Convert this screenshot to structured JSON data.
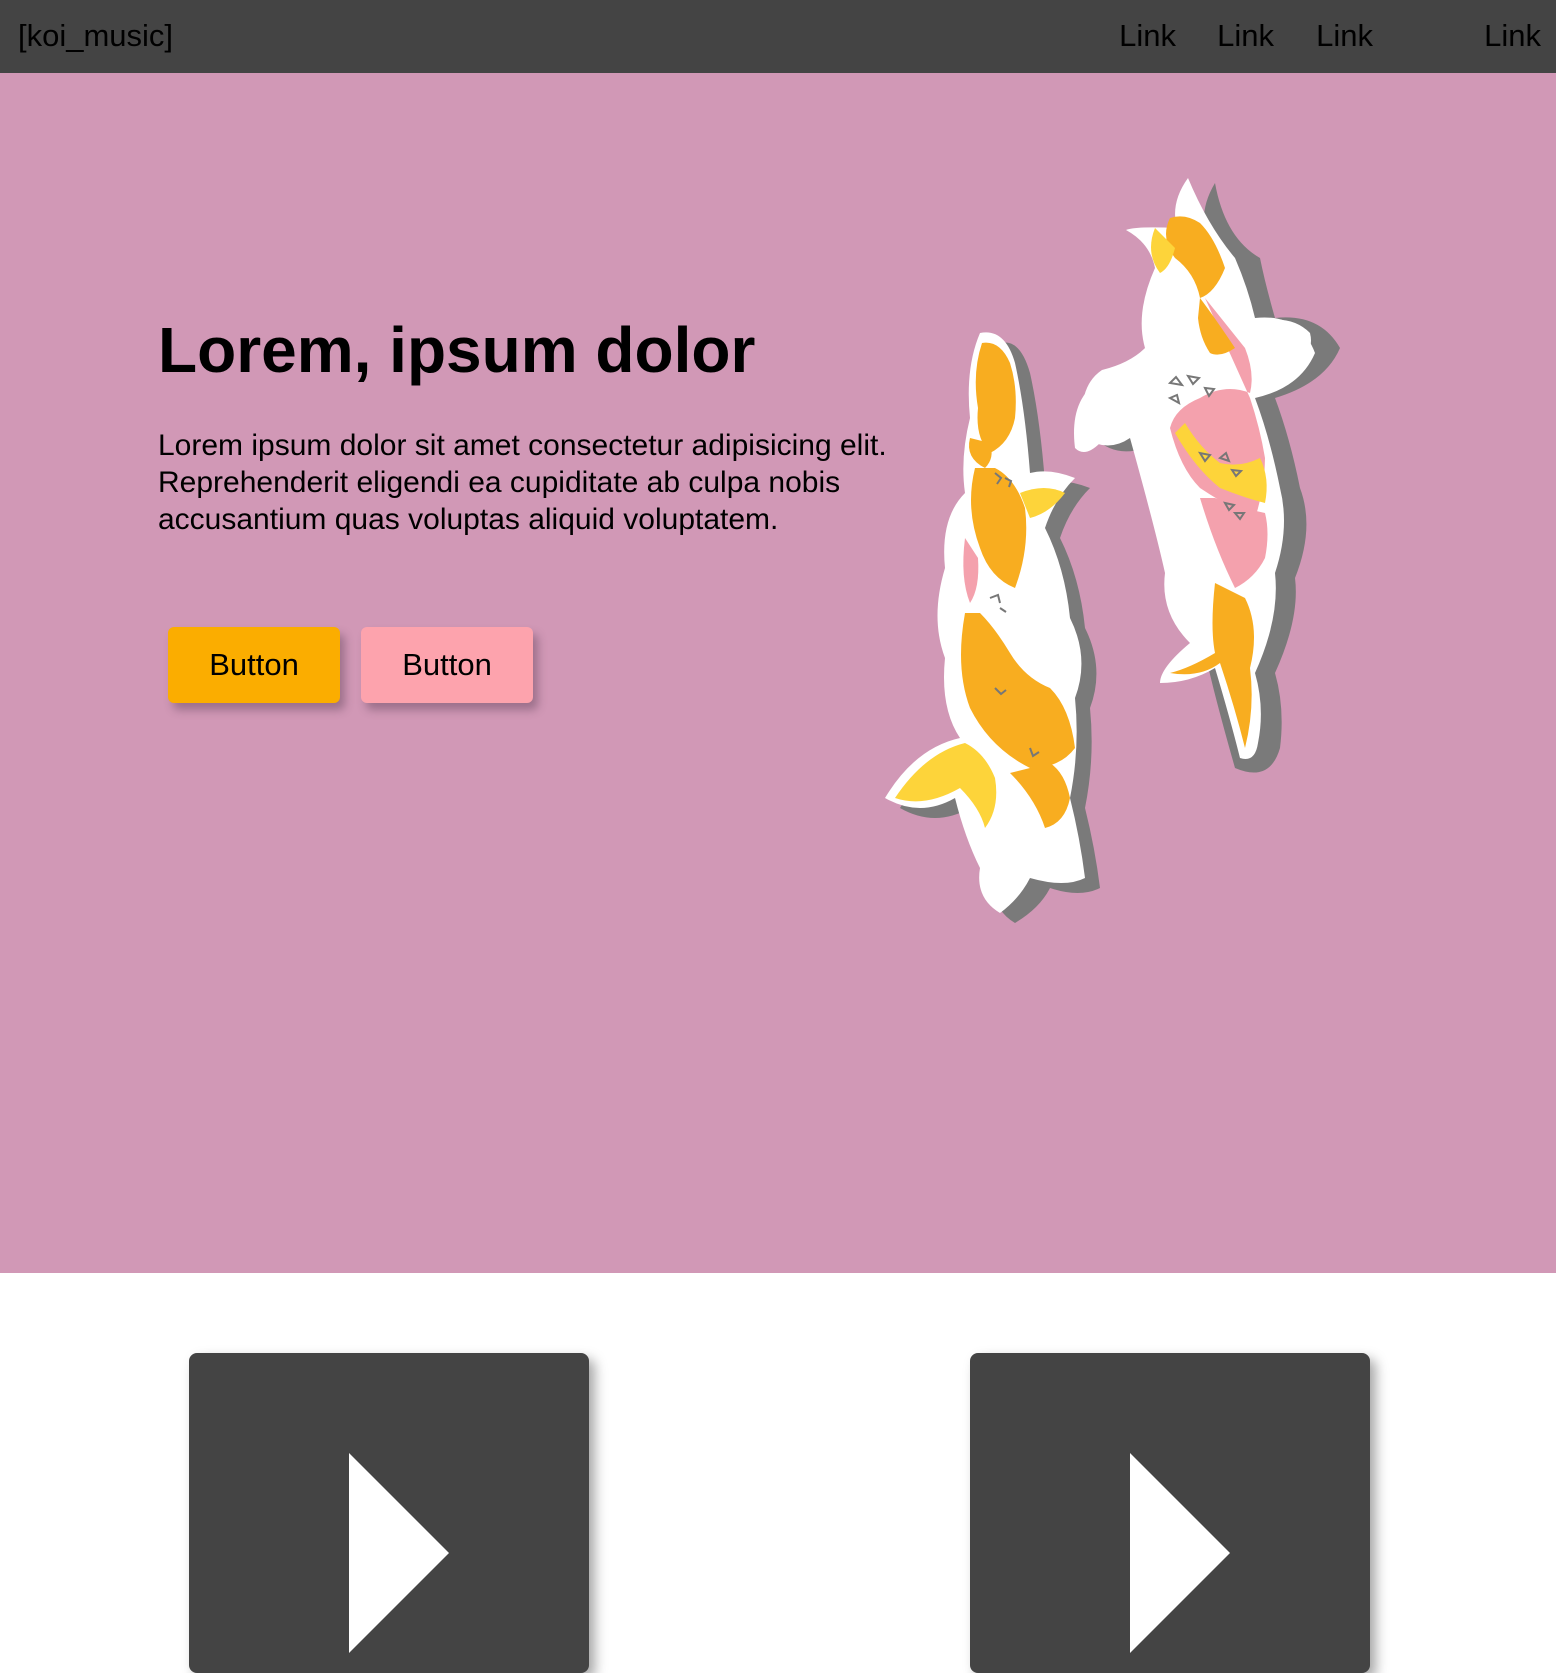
{
  "header": {
    "brand": "[koi_music]",
    "links": [
      "Link",
      "Link",
      "Link",
      "Link"
    ]
  },
  "hero": {
    "title": "Lorem, ipsum dolor",
    "body": "Lorem ipsum dolor sit amet consectetur adipisicing elit. Reprehenderit eligendi ea cupiditate ab culpa nobis accusantium quas voluptas aliquid voluptatem.",
    "primary_button": "Button",
    "secondary_button": "Button",
    "illustration": "koi-fish-illustration"
  },
  "media": {
    "cards": [
      {
        "icon": "play-icon"
      },
      {
        "icon": "play-icon"
      }
    ]
  },
  "colors": {
    "header_bg": "#444444",
    "hero_bg": "#d198b6",
    "primary_button": "#fbad00",
    "secondary_button": "#fda3ad",
    "card_bg": "#444444"
  }
}
